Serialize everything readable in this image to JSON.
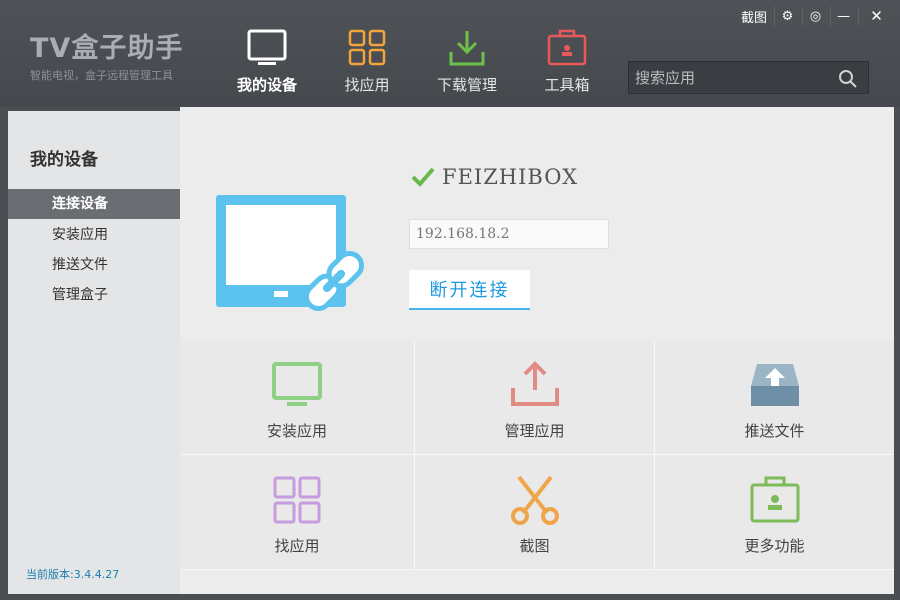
{
  "app": {
    "logo_title": "TV盒子助手",
    "logo_subtitle": "智能电视，盒子远程管理工具"
  },
  "window_controls": {
    "screenshot": "截图",
    "settings": "⚙",
    "feedback": "◎",
    "minimize": "—",
    "close": "✕"
  },
  "nav": [
    {
      "label": "我的设备",
      "icon": "tv-icon",
      "active": true
    },
    {
      "label": "找应用",
      "icon": "grid-icon",
      "active": false
    },
    {
      "label": "下载管理",
      "icon": "download-icon",
      "active": false
    },
    {
      "label": "工具箱",
      "icon": "toolbox-icon",
      "active": false
    }
  ],
  "search": {
    "placeholder": "搜索应用"
  },
  "sidebar": {
    "title": "我的设备",
    "items": [
      {
        "label": "连接设备",
        "active": true
      },
      {
        "label": "安装应用",
        "active": false
      },
      {
        "label": "推送文件",
        "active": false
      },
      {
        "label": "管理盒子",
        "active": false
      }
    ],
    "version": "当前版本:3.4.4.27"
  },
  "device": {
    "name": "FEIZHIBOX",
    "ip": "192.168.18.2",
    "disconnect_label": "断开连接",
    "status": "connected"
  },
  "tiles": [
    {
      "label": "安装应用",
      "icon": "monitor-icon",
      "color": "#8fcf86"
    },
    {
      "label": "管理应用",
      "icon": "upload-icon",
      "color": "#e08b84"
    },
    {
      "label": "推送文件",
      "icon": "inbox-icon",
      "color": "#6f8fa6"
    },
    {
      "label": "找应用",
      "icon": "grid-icon",
      "color": "#c79be0"
    },
    {
      "label": "截图",
      "icon": "scissors-icon",
      "color": "#efa64a"
    },
    {
      "label": "更多功能",
      "icon": "toolbox-icon",
      "color": "#7dbb59"
    }
  ],
  "colors": {
    "accent": "#1d9be0",
    "device_blue": "#5cc3ee",
    "check_green": "#6ab84a"
  }
}
